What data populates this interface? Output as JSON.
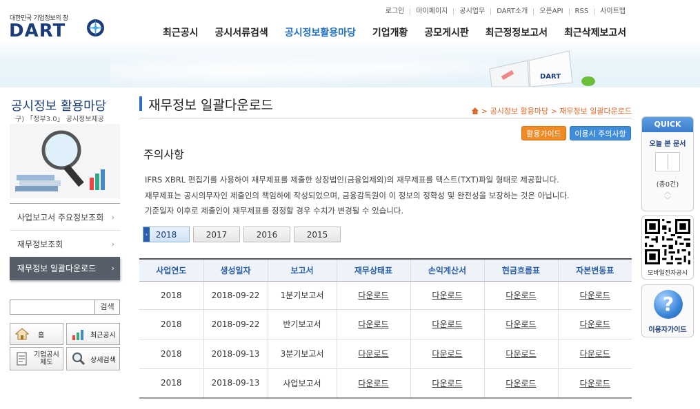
{
  "header": {
    "logo_sub": "대한민국 기업정보의 창",
    "logo_text": "DART",
    "util_links": [
      "로그인",
      "마이페이지",
      "공시업무",
      "DART소개",
      "오픈API",
      "RSS",
      "사이트맵"
    ],
    "gnb": [
      "최근공시",
      "공시서류검색",
      "공시정보활용마당",
      "기업개황",
      "공모게시판",
      "최근정정보고서",
      "최근삭제보고서"
    ],
    "gnb_active": "공시정보활용마당"
  },
  "lnb": {
    "title": "공시정보 활용마당",
    "subtitle": "구) 「정부3.0」 공시정보제공",
    "items": [
      {
        "label": "사업보고서 주요정보조회"
      },
      {
        "label": "재무정보조회"
      },
      {
        "label": "재무정보 일괄다운로드"
      }
    ],
    "search_button": "검색",
    "quick_buttons": [
      {
        "label": "홈",
        "icon": "house-icon"
      },
      {
        "label": "최근공시",
        "icon": "bar-chart-icon"
      },
      {
        "label": "기업공시\n제도",
        "icon": "document-icon"
      },
      {
        "label": "상세검색",
        "icon": "magnifier-icon"
      }
    ]
  },
  "content": {
    "title": "재무정보 일괄다운로드",
    "breadcrumb": "> 공시정보 활용마당 > 재무정보 일괄다운로드",
    "guide_button": "활용가이드",
    "caution_button": "이용시 주의사항",
    "notice_title": "주의사항",
    "notices": [
      "IFRS XBRL 편집기를 사용하여 재무제표를 제출한 상장법인(금융업제외)의 재무제표를 텍스트(TXT)파일 형태로 제공합니다.",
      "재무제표는 공시의무자인 제출인의 책임하에 작성되었으며, 금융감독원이 이 정보의 정확성 및 완전성을 보장하는 것은 아닙니다.",
      "기준일자 이후로 제출인이 재무제표를 정정할 경우 수치가 변경될 수 있습니다."
    ],
    "year_tabs": [
      "2018",
      "2017",
      "2016",
      "2015"
    ],
    "active_year": "2018",
    "table": {
      "headers": [
        "사업연도",
        "생성일자",
        "보고서",
        "재무상태표",
        "손익계산서",
        "현금흐름표",
        "자본변동표"
      ],
      "rows": [
        [
          "2018",
          "2018-09-22",
          "1분기보고서",
          "다운로드",
          "다운로드",
          "다운로드",
          "다운로드"
        ],
        [
          "2018",
          "2018-09-22",
          "반기보고서",
          "다운로드",
          "다운로드",
          "다운로드",
          "다운로드"
        ],
        [
          "2018",
          "2018-09-13",
          "3분기보고서",
          "다운로드",
          "다운로드",
          "다운로드",
          "다운로드"
        ],
        [
          "2018",
          "2018-09-13",
          "사업보고서",
          "다운로드",
          "다운로드",
          "다운로드",
          "다운로드"
        ]
      ]
    }
  },
  "quick": {
    "head": "QUICK",
    "today": "오늘 본 문서",
    "count": "(총0건)",
    "qr_label": "모바일전자공시",
    "help_label": "이용자가이드"
  },
  "colors": {
    "brand_navy": "#1b3c7a",
    "accent_blue": "#2d6ec2",
    "orange": "#f08a24"
  }
}
